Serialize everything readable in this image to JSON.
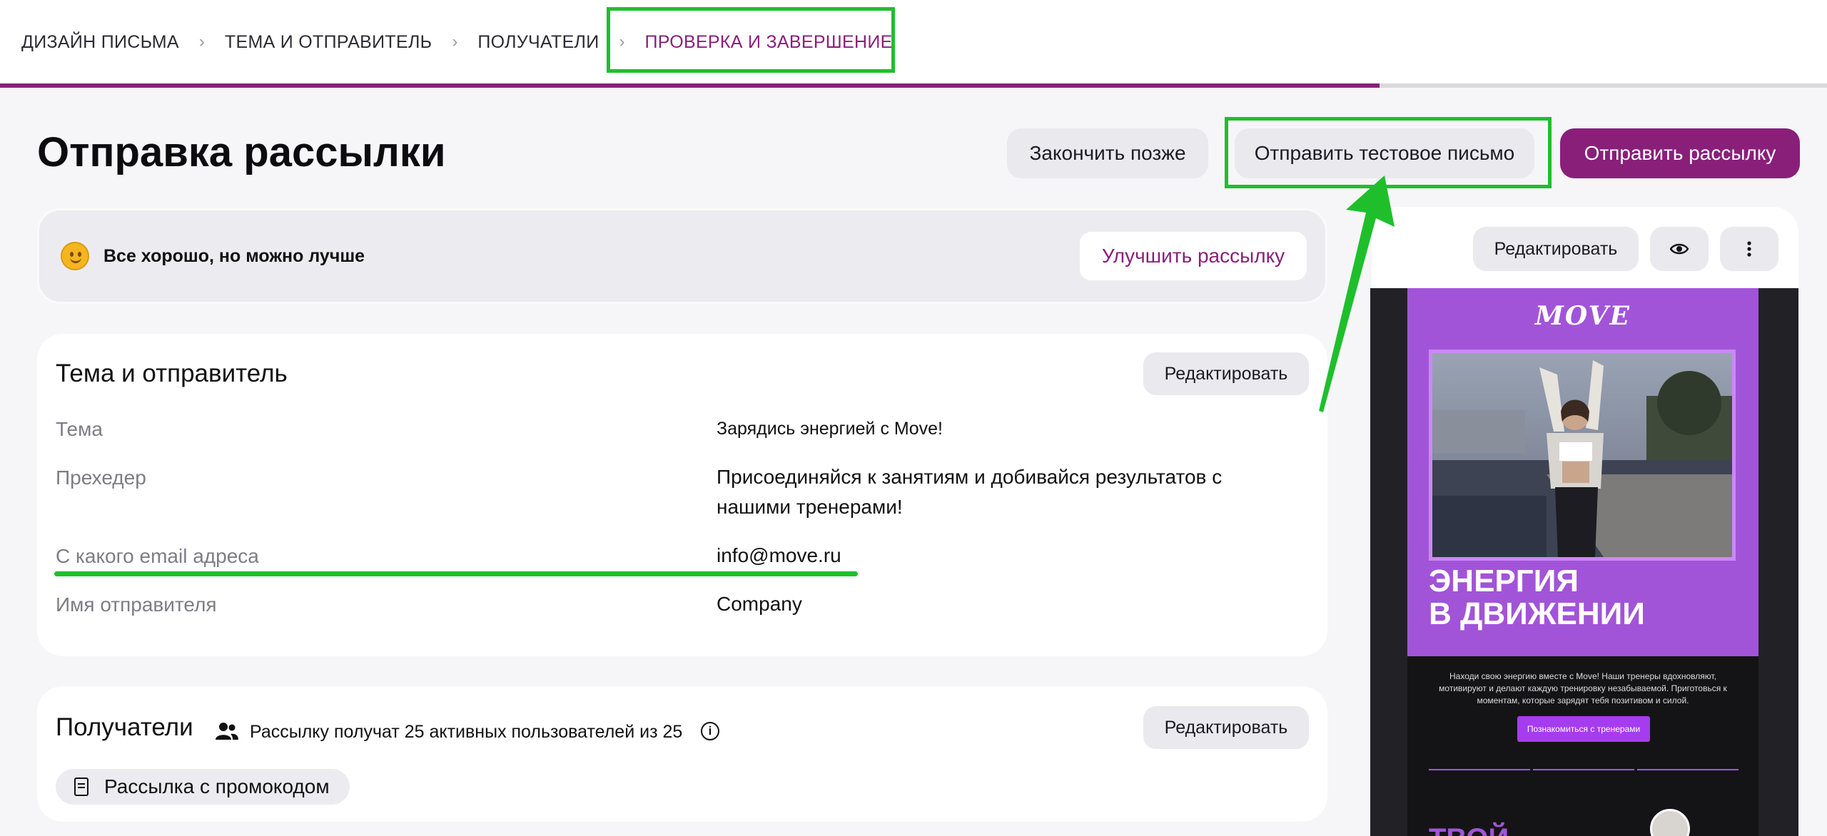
{
  "stepper": {
    "steps": [
      {
        "label": "ДИЗАЙН ПИСЬМА"
      },
      {
        "label": "ТЕМА И ОТПРАВИТЕЛЬ"
      },
      {
        "label": "ПОЛУЧАТЕЛИ"
      },
      {
        "label": "ПРОВЕРКА И ЗАВЕРШЕНИЕ"
      }
    ],
    "active_index": 3,
    "progress": 0.755
  },
  "header": {
    "title": "Отправка рассылки",
    "finish_later": "Закончить позже",
    "send_test": "Отправить тестовое письмо",
    "send_campaign": "Отправить рассылку"
  },
  "quality": {
    "text": "Все хорошо, но можно лучше",
    "improve_button": "Улучшить рассылку"
  },
  "sender_card": {
    "title": "Тема и отправитель",
    "edit_button": "Редактировать",
    "fields": [
      {
        "label": "Тема",
        "value": "Зарядись энергией с Move!"
      },
      {
        "label": "Прехедер",
        "value": "Присоединяйся к занятиям и добивайся результатов с нашими тренерами!"
      },
      {
        "label": "С какого email адреса",
        "value": "info@move.ru"
      },
      {
        "label": "Имя отправителя",
        "value": "Company"
      }
    ]
  },
  "recipients_card": {
    "title": "Получатели",
    "summary": "Рассылку получат 25 активных пользователей из 25",
    "edit_button": "Редактировать",
    "tag": "Рассылка с промокодом"
  },
  "preview": {
    "edit_button": "Редактировать",
    "icons": [
      "eye-icon",
      "more-vertical-icon"
    ],
    "email": {
      "logo": "MOVE",
      "headline_line1": "ЭНЕРГИЯ",
      "headline_line2": "В ДВИЖЕНИИ",
      "body": "Находи свою энергию вместе с Move! Наши тренеры вдохновляют, мотивируют и делают каждую тренировку незабываемой. Приготовься к моментам, которые зарядят тебя позитивом и силой.",
      "cta": "Познакомиться с тренерами",
      "footer_title": "ТВОЙ"
    }
  },
  "colors": {
    "accent": "#8a1f7a",
    "annotation_green": "#1fbf2c",
    "email_purple": "#a154d8"
  }
}
